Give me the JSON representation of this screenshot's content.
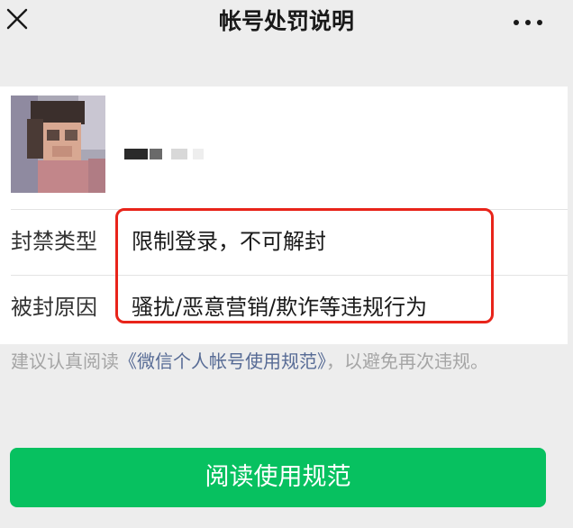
{
  "header": {
    "title": "帐号处罚说明",
    "close_icon": "close-icon",
    "more_icon": "more-horizontal-icon"
  },
  "profile": {
    "avatar": "avatar-blurred-photo"
  },
  "details": {
    "ban_type_label": "封禁类型",
    "ban_type_value": "限制登录，不可解封",
    "ban_reason_label": "被封原因",
    "ban_reason_value": "骚扰/恶意营销/欺诈等违规行为"
  },
  "notice": {
    "prefix": "建议认真阅读",
    "link_text": "《微信个人帐号使用规范》",
    "suffix": "，以避免再次违规。"
  },
  "button": {
    "label": "阅读使用规范"
  },
  "colors": {
    "primary": "#07c160",
    "link": "#576b95",
    "highlight_border": "#e8241a",
    "background": "#ededed"
  }
}
